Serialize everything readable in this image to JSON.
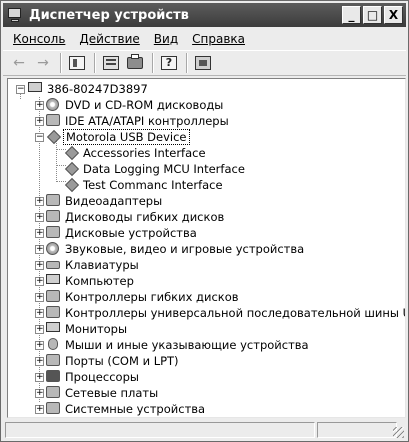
{
  "window": {
    "title": "Диспетчер устройств",
    "controls": {
      "minimize": "_",
      "maximize": "□",
      "close": "X"
    }
  },
  "menu": {
    "items": [
      "Консоль",
      "Действие",
      "Вид",
      "Справка"
    ]
  },
  "toolbar": {
    "buttons": [
      "back-arrow-icon",
      "forward-arrow-icon",
      "console-tree-icon",
      "properties-icon",
      "print-icon",
      "help-icon",
      "update-driver-icon"
    ]
  },
  "tree": {
    "root": "386-80247D3897",
    "categories": [
      {
        "label": "DVD и CD-ROM дисководы",
        "icon": "disc-drive-icon",
        "expanded": false
      },
      {
        "label": "IDE ATA/ATAPI контроллеры",
        "icon": "ide-controller-icon",
        "expanded": false
      },
      {
        "label": "Motorola USB Device",
        "icon": "usb-device-icon",
        "expanded": true,
        "selected": true,
        "children": [
          "Accessories Interface",
          "Data Logging MCU Interface",
          "Test Commanc Interface"
        ]
      },
      {
        "label": "Видеоадаптеры",
        "icon": "video-adapter-icon",
        "expanded": false
      },
      {
        "label": "Дисководы гибких дисков",
        "icon": "floppy-drive-icon",
        "expanded": false
      },
      {
        "label": "Дисковые устройства",
        "icon": "disk-drive-icon",
        "expanded": false
      },
      {
        "label": "Звуковые, видео и игровые устройства",
        "icon": "sound-icon",
        "expanded": false
      },
      {
        "label": "Клавиатуры",
        "icon": "keyboard-icon",
        "expanded": false
      },
      {
        "label": "Компьютер",
        "icon": "computer-icon",
        "expanded": false
      },
      {
        "label": "Контроллеры гибких дисков",
        "icon": "floppy-controller-icon",
        "expanded": false
      },
      {
        "label": "Контроллеры универсальной последовательной шины USB",
        "icon": "usb-controller-icon",
        "expanded": false
      },
      {
        "label": "Мониторы",
        "icon": "monitor-icon",
        "expanded": false
      },
      {
        "label": "Мыши и иные указывающие устройства",
        "icon": "mouse-icon",
        "expanded": false
      },
      {
        "label": "Порты (COM и LPT)",
        "icon": "port-icon",
        "expanded": false
      },
      {
        "label": "Процессоры",
        "icon": "processor-icon",
        "expanded": false
      },
      {
        "label": "Сетевые платы",
        "icon": "network-card-icon",
        "expanded": false
      },
      {
        "label": "Системные устройства",
        "icon": "system-device-icon",
        "expanded": false
      }
    ]
  },
  "statusbar": {
    "text": ""
  }
}
